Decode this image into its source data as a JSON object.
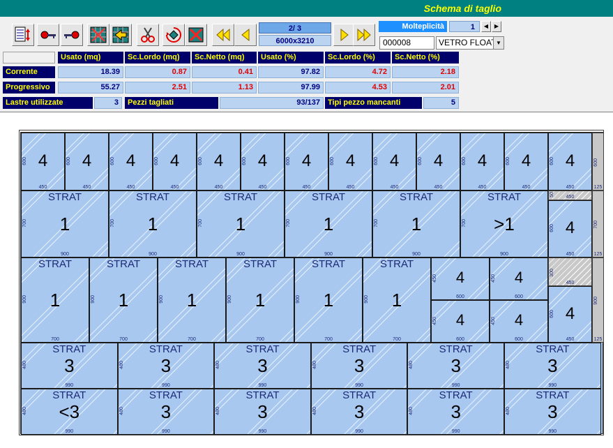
{
  "title": "Schema di taglio",
  "toolbar": {
    "buttons": [
      "optimize-icon",
      "key-left-icon",
      "key-right-icon",
      "grid-icon",
      "grid-arrow-icon",
      "scissors-icon",
      "rotate-icon",
      "cancel-icon"
    ],
    "first_icon": "double-left-arrow-icon",
    "prev_icon": "left-arrow-icon",
    "next_icon": "right-arrow-icon",
    "last_icon": "double-right-arrow-icon",
    "page": "2/  3",
    "sheet_size": "6000x3210"
  },
  "multiplicity": {
    "label": "Molteplicità",
    "value": "1"
  },
  "code": "000008",
  "material": "VETRO FLOAT",
  "stats": {
    "headers": [
      "Usato (mq)",
      "Sc.Lordo (mq)",
      "Sc.Netto (mq)",
      "Usato (%)",
      "Sc.Lordo (%)",
      "Sc.Netto (%)"
    ],
    "rows": [
      {
        "label": "Corrente",
        "values": [
          "18.39",
          "0.87",
          "0.41",
          "97.82",
          "4.72",
          "2.18"
        ]
      },
      {
        "label": "Progressivo",
        "values": [
          "55.27",
          "2.51",
          "1.13",
          "97.99",
          "4.53",
          "2.01"
        ]
      }
    ],
    "lastre_label": "Lastre utilizzate",
    "lastre_value": "3",
    "pezzi_label": "Pezzi tagliati",
    "pezzi_value": "93/137",
    "tipi_label": "Tipi pezzo mancanti",
    "tipi_value": "5"
  },
  "scheme": {
    "row1": {
      "label": "4",
      "w": "450",
      "h": "600",
      "count": 13,
      "waste_w": "125",
      "waste_h": "600"
    },
    "row2": {
      "label": "STRAT",
      "w": "900",
      "h": "700",
      "nums": [
        "1",
        "1",
        "1",
        "1",
        "1",
        ">1"
      ],
      "side": {
        "num": "4",
        "w": "450",
        "h": "600"
      },
      "side_waste": "450",
      "side_waste_h": "50",
      "waste_w": "125",
      "waste_h": "700"
    },
    "row3": {
      "label": "STRAT",
      "w": "700",
      "h": "900",
      "nums": [
        "1",
        "1",
        "1",
        "1",
        "1",
        "1"
      ],
      "small": {
        "num": "4",
        "w": "600",
        "h": "450"
      },
      "side": {
        "num": "4",
        "w": "450",
        "h": "600"
      },
      "side_waste": "450",
      "side_waste_h": "300",
      "waste_w": "125",
      "waste_h": "900"
    },
    "row4": {
      "label": "STRAT",
      "w": "990",
      "h": "480",
      "nums": [
        "3",
        "3",
        "3",
        "3",
        "3",
        "3"
      ]
    },
    "row5": {
      "label": "STRAT",
      "w": "990",
      "h": "480",
      "nums": [
        "<3",
        "3",
        "3",
        "3",
        "3",
        "3"
      ]
    }
  }
}
